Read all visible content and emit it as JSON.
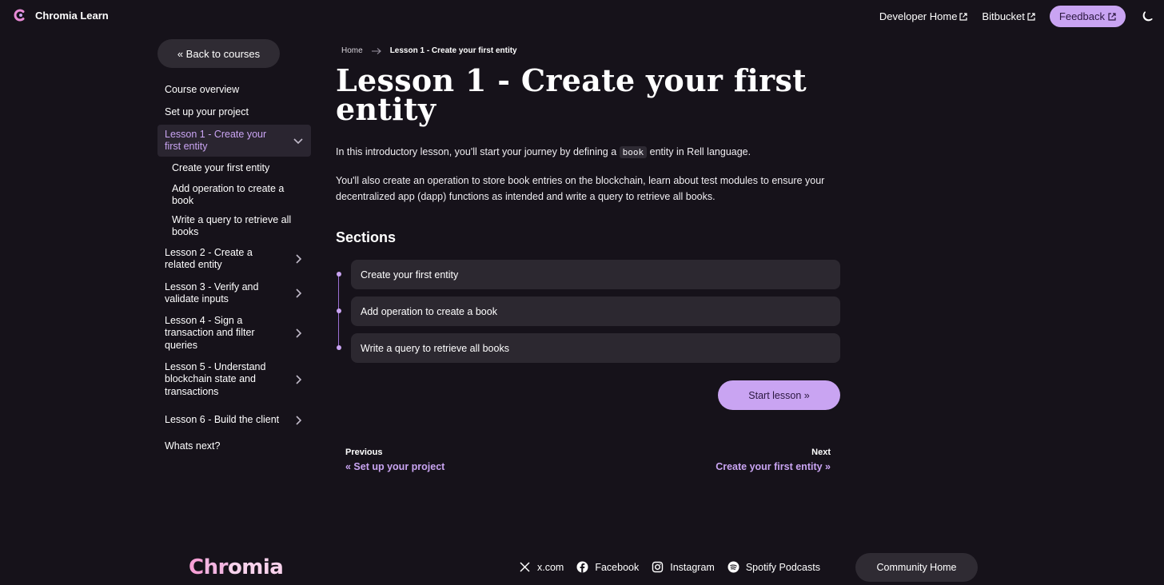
{
  "header": {
    "brand": "Chromia Learn",
    "developer_home": "Developer Home",
    "bitbucket": "Bitbucket",
    "feedback": "Feedback",
    "theme_icon": "moon-icon"
  },
  "sidebar": {
    "back": "« Back to courses",
    "items": [
      {
        "label": "Course overview"
      },
      {
        "label": "Set up your project"
      },
      {
        "label": "Lesson 1 - Create your first entity",
        "expanded": true,
        "active": true
      },
      {
        "label": "Create your first entity",
        "sub": true
      },
      {
        "label": "Add operation to create a book",
        "sub": true
      },
      {
        "label": "Write a query to retrieve all books",
        "sub": true
      },
      {
        "label": "Lesson 2 - Create a related entity",
        "expanded": false
      },
      {
        "label": "Lesson 3 - Verify and validate inputs",
        "expanded": false
      },
      {
        "label": "Lesson 4 - Sign a transaction and filter queries",
        "expanded": false
      },
      {
        "label": "Lesson 5 - Understand blockchain state and transactions",
        "expanded": false
      },
      {
        "label": "Lesson 6 - Build the client",
        "expanded": false
      },
      {
        "label": "Whats next?"
      }
    ]
  },
  "breadcrumb": {
    "home": "Home",
    "current": "Lesson 1 - Create your first entity"
  },
  "main": {
    "title": "Lesson 1 - Create your first entity",
    "intro_before": "In this introductory lesson, you'll start your journey by defining a ",
    "intro_code": "book",
    "intro_after": " entity in Rell language.",
    "para2": "You'll also create an operation to store book entries on the blockchain, learn about test modules to ensure your decentralized app (dapp) functions as intended and write a query to retrieve all books.",
    "sections_heading": "Sections",
    "sections": [
      "Create your first entity",
      "Add operation to create a book",
      "Write a query to retrieve all books"
    ],
    "start_button": "Start lesson »"
  },
  "pagination": {
    "prev_label": "Previous",
    "prev_link": "« Set up your project",
    "next_label": "Next",
    "next_link": "Create your first entity »"
  },
  "footer": {
    "logo_text": "Chromia",
    "social": [
      {
        "label": "x.com",
        "icon": "x-icon"
      },
      {
        "label": "Facebook",
        "icon": "facebook-icon"
      },
      {
        "label": "Instagram",
        "icon": "instagram-icon"
      },
      {
        "label": "Spotify Podcasts",
        "icon": "spotify-icon"
      }
    ],
    "community": "Community Home"
  },
  "colors": {
    "background": "#16121a",
    "accent": "#c9a4f2",
    "panel": "#2c2830"
  }
}
